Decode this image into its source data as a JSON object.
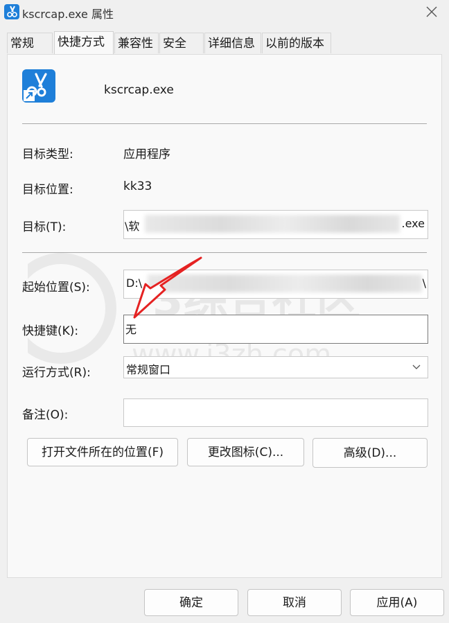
{
  "window": {
    "title": "kscrcap.exe 属性",
    "close_glyph": "✕"
  },
  "tabs": [
    {
      "label": "常规"
    },
    {
      "label": "快捷方式",
      "active": true
    },
    {
      "label": "兼容性"
    },
    {
      "label": "安全"
    },
    {
      "label": "详细信息"
    },
    {
      "label": "以前的版本"
    }
  ],
  "file": {
    "name": "kscrcap.exe",
    "icon": "scissors-app-icon",
    "icon_color": "#1e7fd9"
  },
  "fields": {
    "target_type": {
      "label": "目标类型:",
      "value": "应用程序"
    },
    "target_location": {
      "label": "目标位置:",
      "value": "kk33"
    },
    "target": {
      "label": "目标(T):",
      "value_start": "\\软",
      "value_end": ".exe"
    },
    "start_in": {
      "label": "起始位置(S):",
      "value_start": "D:\\",
      "value_end": "\\"
    },
    "shortcut_key": {
      "label": "快捷键(K):",
      "value": "无"
    },
    "run": {
      "label": "运行方式(R):",
      "value": "常规窗口"
    },
    "comment": {
      "label": "备注(O):",
      "value": ""
    }
  },
  "buttons": {
    "open_location": "打开文件所在的位置(F)",
    "change_icon": "更改图标(C)...",
    "advanced": "高级(D)..."
  },
  "footer": {
    "ok": "确定",
    "cancel": "取消",
    "apply": "应用(A)"
  },
  "watermark": {
    "text": "3综合社区",
    "url": "www.i3zh.com"
  },
  "annotation_color": "#e52222"
}
